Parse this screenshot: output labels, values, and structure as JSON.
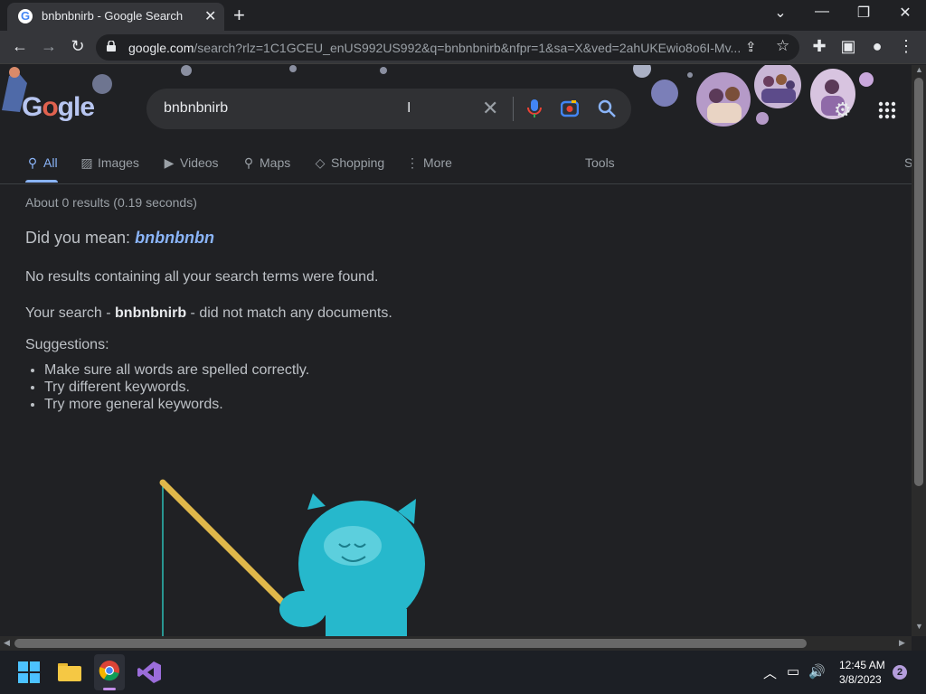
{
  "browser": {
    "tab_title": "bnbnbnirb - Google Search",
    "tab_close": "✕",
    "new_tab": "+",
    "url_host": "google.com",
    "url_path": "/search?rlz=1C1GCEU_enUS992US992&q=bnbnbnirb&nfpr=1&sa=X&ved=2ahUKEwio8o6I-Mv..."
  },
  "search": {
    "query": "bnbnbnirb"
  },
  "search_tabs": [
    {
      "label": "All",
      "icon": "search-icon"
    },
    {
      "label": "Images",
      "icon": "image-icon"
    },
    {
      "label": "Videos",
      "icon": "play-icon"
    },
    {
      "label": "Maps",
      "icon": "map-pin-icon"
    },
    {
      "label": "Shopping",
      "icon": "tag-icon"
    },
    {
      "label": "More",
      "icon": "kebab-icon"
    }
  ],
  "tools_label": "Tools",
  "safe_label": "S",
  "results": {
    "stats": "About 0 results (0.19 seconds)",
    "did_you_mean": "Did you mean:",
    "did_you_mean_term": "bnbnbnbn",
    "no_results": "No results containing all your search terms were found.",
    "no_match_prefix": "Your search - ",
    "no_match_term": "bnbnbnirb",
    "no_match_suffix": " - did not match any documents.",
    "suggestions_title": "Suggestions:",
    "suggestions": [
      "Make sure all words are spelled correctly.",
      "Try different keywords.",
      "Try more general keywords."
    ]
  },
  "logo_text": {
    "g": "G",
    "o": "o",
    "rest": "gle"
  },
  "taskbar": {
    "time": "12:45 AM",
    "date": "3/8/2023",
    "notifications": "2"
  }
}
